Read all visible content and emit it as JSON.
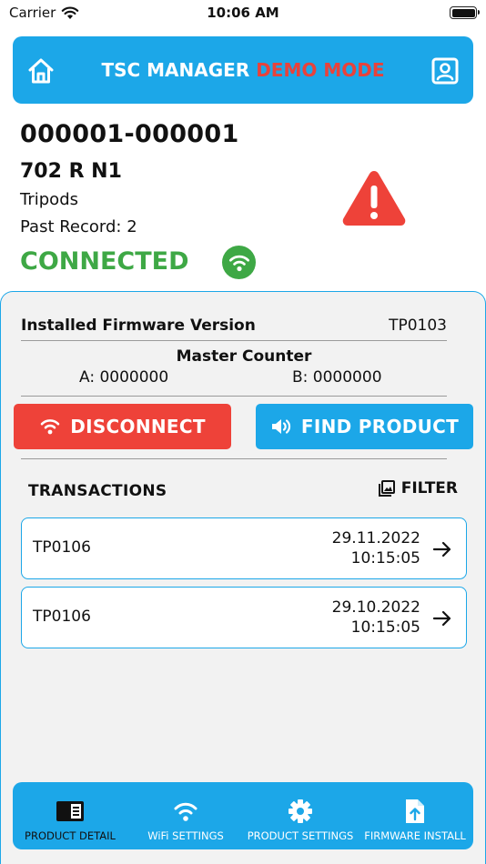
{
  "status_bar": {
    "carrier": "Carrier",
    "time": "10:06 AM"
  },
  "header": {
    "title": "TSC MANAGER",
    "mode": "DEMO MODE",
    "home_icon": "home-icon",
    "profile_icon": "profile-icon"
  },
  "product": {
    "serial": "000001-000001",
    "model": "702 R N1",
    "category": "Tripods",
    "past_record": "Past Record: 2",
    "connection_status": "CONNECTED"
  },
  "firmware": {
    "label": "Installed Firmware Version",
    "value": "TP0103"
  },
  "master_counter": {
    "label": "Master Counter",
    "a": "A: 0000000",
    "b": "B: 0000000"
  },
  "actions": {
    "disconnect": "DISCONNECT",
    "find_product": "FIND PRODUCT"
  },
  "transactions": {
    "label": "TRANSACTIONS",
    "filter": "FILTER",
    "items": [
      {
        "code": "TP0106",
        "date": "29.11.2022",
        "time": "10:15:05"
      },
      {
        "code": "TP0106",
        "date": "29.10.2022",
        "time": "10:15:05"
      }
    ]
  },
  "tabs": [
    {
      "label": "PRODUCT DETAIL",
      "icon": "product-detail-icon",
      "active": true
    },
    {
      "label": "WiFi SETTINGS",
      "icon": "wifi-icon",
      "active": false
    },
    {
      "label": "PRODUCT SETTINGS",
      "icon": "gear-icon",
      "active": false
    },
    {
      "label": "FIRMWARE INSTALL",
      "icon": "upload-file-icon",
      "active": false
    }
  ],
  "colors": {
    "primary": "#1ca7e8",
    "danger": "#ee4239",
    "success": "#3ea845",
    "demo": "#e8423b"
  }
}
